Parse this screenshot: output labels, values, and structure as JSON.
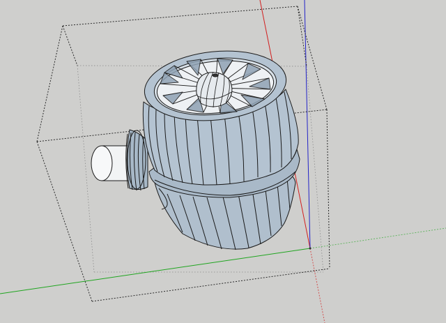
{
  "viewport": {
    "background": "#cfcfcd",
    "view": "3d-model-viewport"
  },
  "axes": {
    "red_axis_color": "#d21e1e",
    "green_axis_color": "#1fa51f",
    "blue_axis_color": "#2222c8"
  },
  "model": {
    "name": "turbofan-engine",
    "face_color": "#b4c3d1",
    "face_shadow_color": "#8fa2b4",
    "edge_color": "#1a1a1a",
    "intake_color": "#e9ecef",
    "bounding_box_color": "#3a3a3a"
  }
}
